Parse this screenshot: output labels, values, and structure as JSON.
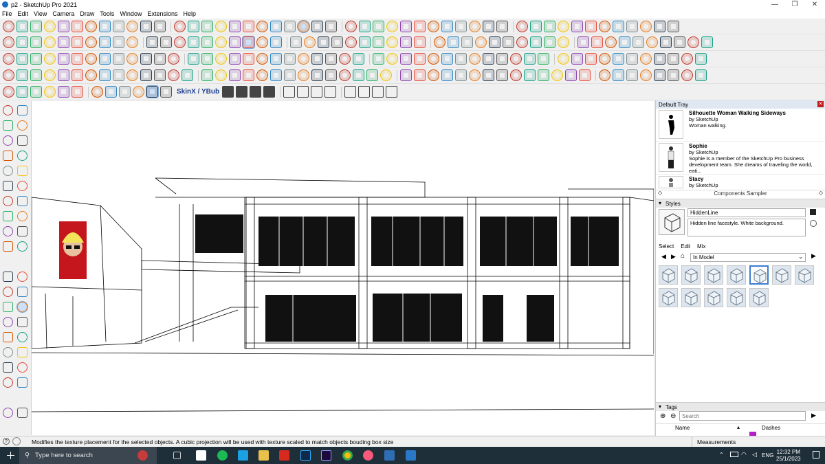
{
  "window": {
    "title": "p2 - SketchUp Pro 2021",
    "controls": [
      "minimize-icon",
      "restore-icon",
      "close-icon"
    ]
  },
  "menu": [
    "File",
    "Edit",
    "View",
    "Camera",
    "Draw",
    "Tools",
    "Window",
    "Extensions",
    "Help"
  ],
  "toolbar": {
    "skinx_label": "SkinX / YBub"
  },
  "tray": {
    "title": "Default Tray",
    "components": [
      {
        "name": "Silhouette Woman Walking Sideways",
        "by": "by SketchUp",
        "desc": "Woman walking."
      },
      {
        "name": "Sophie",
        "by": "by SketchUp",
        "desc": "Sophie is a member of the SketchUp Pro business development team. She dreams of traveling the world, eati..."
      },
      {
        "name": "Stacy",
        "by": "by SketchUp",
        "desc": ""
      }
    ],
    "components_sampler": "Components Sampler",
    "styles": {
      "header": "Styles",
      "name": "HiddenLine",
      "description": "Hidden line facestyle. White background.",
      "tabs": [
        "Select",
        "Edit",
        "Mix"
      ],
      "library": "In Model"
    },
    "tags": {
      "header": "Tags",
      "search_placeholder": "Search",
      "col_name": "Name",
      "col_dashes": "Dashes"
    }
  },
  "statusbar": {
    "message": "Modifies the texture placement for the selected objects. A cubic projection will be used with texture scaled to match objects bouding box size",
    "measurements_label": "Measurements"
  },
  "taskbar": {
    "search_placeholder": "Type here to search",
    "language": "ENG",
    "time": "12:32 PM",
    "date": "25/1/2023"
  },
  "colors": {
    "accent": "#3a7bd5",
    "taskbar": "#1f2f3a"
  }
}
